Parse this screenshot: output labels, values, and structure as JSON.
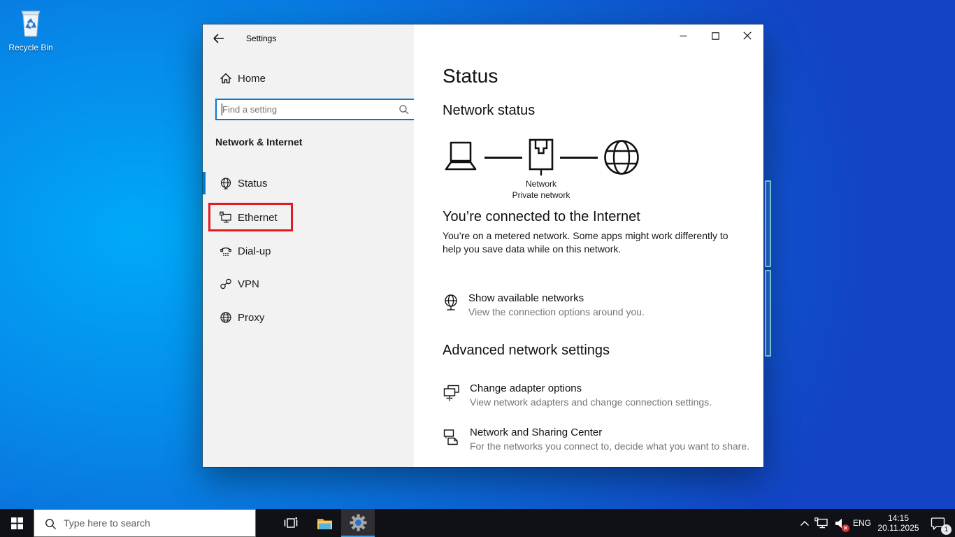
{
  "desktop": {
    "recycle_bin_label": "Recycle Bin"
  },
  "window": {
    "title": "Settings",
    "sidebar": {
      "home_label": "Home",
      "search_placeholder": "Find a setting",
      "section_header": "Network & Internet",
      "items": [
        {
          "label": "Status"
        },
        {
          "label": "Ethernet"
        },
        {
          "label": "Dial-up"
        },
        {
          "label": "VPN"
        },
        {
          "label": "Proxy"
        }
      ]
    },
    "main": {
      "page_title": "Status",
      "network_status_heading": "Network status",
      "diagram": {
        "network_label": "Network",
        "network_type": "Private network"
      },
      "connection_title": "You’re connected to the Internet",
      "connection_body": "You’re on a metered network. Some apps might work differently to help you save data while on this network.",
      "show_networks": {
        "title": "Show available networks",
        "subtitle": "View the connection options around you."
      },
      "advanced_heading": "Advanced network settings",
      "advanced": [
        {
          "title": "Change adapter options",
          "subtitle": "View network adapters and change connection settings."
        },
        {
          "title": "Network and Sharing Center",
          "subtitle": "For the networks you connect to, decide what you want to share."
        }
      ]
    }
  },
  "taskbar": {
    "search_placeholder": "Type here to search",
    "tray": {
      "language": "ENG",
      "time": "14:15",
      "date": "20.11.2025",
      "notification_count": "1"
    }
  },
  "colors": {
    "accent": "#0078d7",
    "annotation_red": "#e01b24",
    "taskbar_underline": "#3aa0f0"
  }
}
